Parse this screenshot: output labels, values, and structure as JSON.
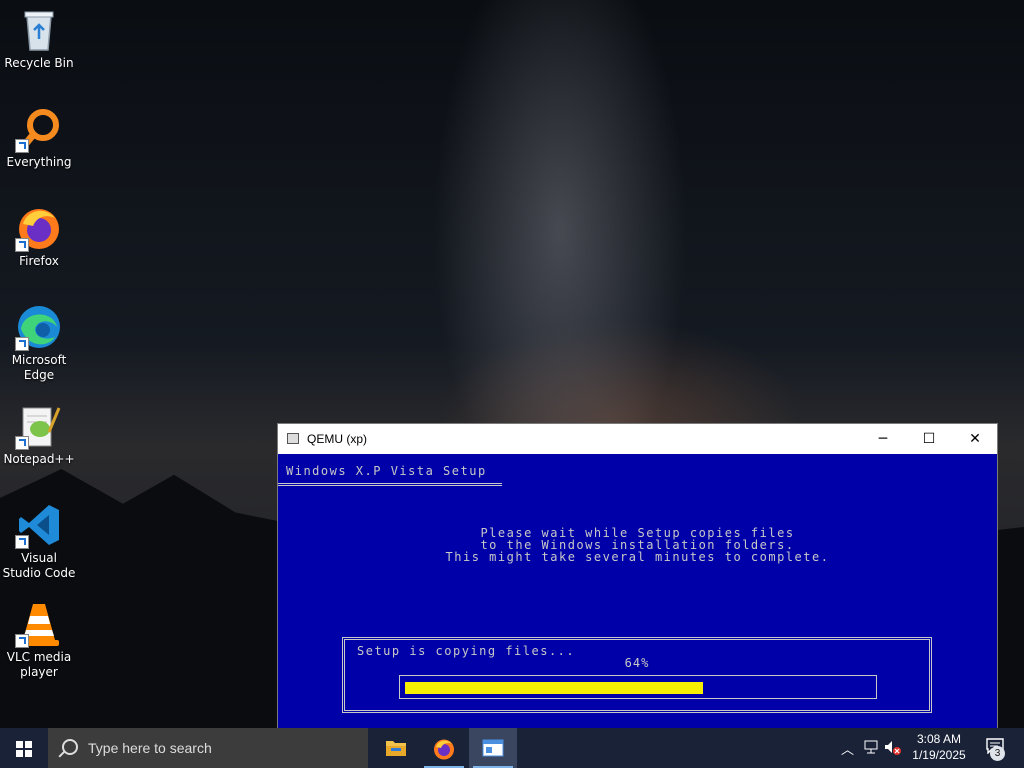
{
  "desktop": {
    "icons": [
      {
        "label": "Recycle Bin"
      },
      {
        "label": "Everything"
      },
      {
        "label": "Firefox"
      },
      {
        "label": "Microsoft Edge"
      },
      {
        "label": "Notepad++"
      },
      {
        "label": "Visual Studio Code"
      },
      {
        "label": "VLC media player"
      }
    ]
  },
  "qemu": {
    "title": "QEMU (xp)",
    "minimize": "─",
    "maximize": "☐",
    "close": "✕",
    "screen": {
      "setup_title": "Windows X.P Vista Setup",
      "message_line1": "Please wait while Setup copies files",
      "message_line2": "to the Windows installation folders.",
      "message_line3": "This might take several minutes to complete.",
      "progress_label": "Setup is copying files...",
      "progress_percent_text": "64%",
      "progress_fraction": 0.64
    }
  },
  "taskbar": {
    "search_placeholder": "Type here to search",
    "time": "3:08 AM",
    "date": "1/19/2025",
    "notification_count": "3"
  },
  "colors": {
    "setup_background": "#0000a8",
    "progress_fill": "#f6f000",
    "taskbar": "#1a2238"
  }
}
